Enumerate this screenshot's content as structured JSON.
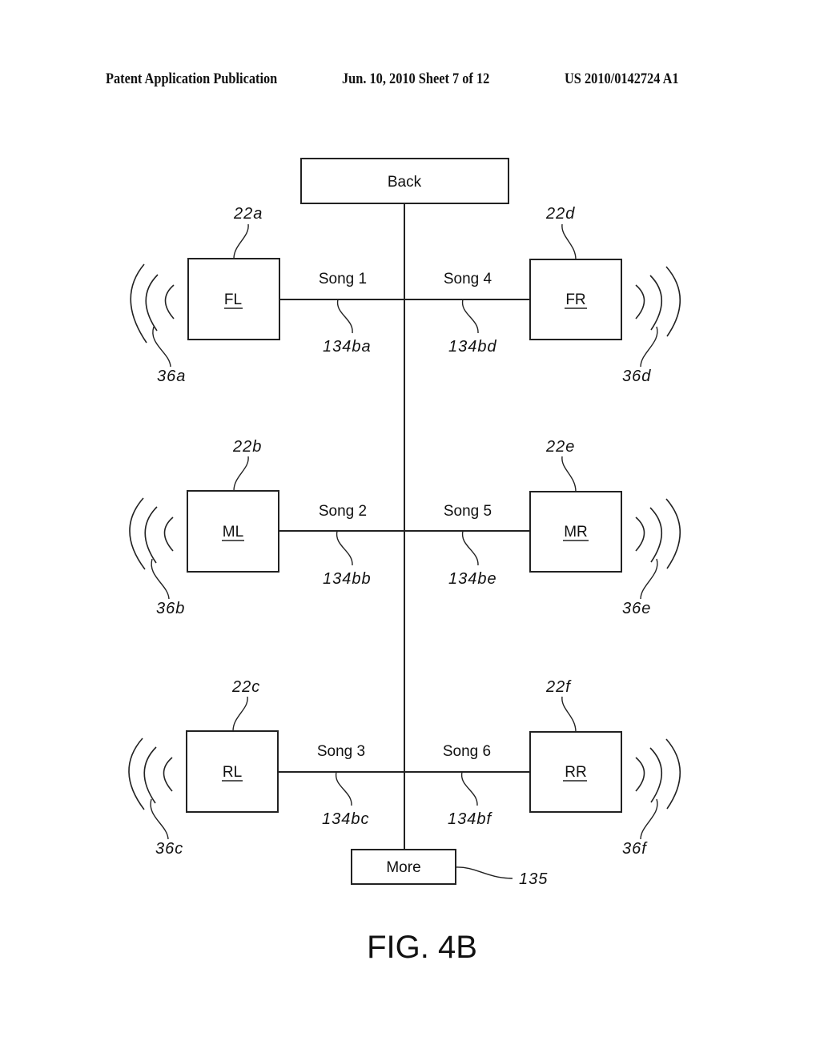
{
  "header": {
    "left": "Patent Application Publication",
    "center": "Jun. 10, 2010  Sheet 7 of 12",
    "right": "US 2010/0142724 A1"
  },
  "diagram": {
    "top_button": "Back",
    "bottom_button": {
      "label": "More",
      "ref": "135"
    },
    "speakers": [
      {
        "id": "FL",
        "ref": "22a",
        "wave_ref": "36a",
        "side": "left",
        "row": 0
      },
      {
        "id": "ML",
        "ref": "22b",
        "wave_ref": "36b",
        "side": "left",
        "row": 1
      },
      {
        "id": "RL",
        "ref": "22c",
        "wave_ref": "36c",
        "side": "left",
        "row": 2
      },
      {
        "id": "FR",
        "ref": "22d",
        "wave_ref": "36d",
        "side": "right",
        "row": 0
      },
      {
        "id": "MR",
        "ref": "22e",
        "wave_ref": "36e",
        "side": "right",
        "row": 1
      },
      {
        "id": "RR",
        "ref": "22f",
        "wave_ref": "36f",
        "side": "right",
        "row": 2
      }
    ],
    "links": [
      {
        "song": "Song 1",
        "ref": "134ba"
      },
      {
        "song": "Song 2",
        "ref": "134bb"
      },
      {
        "song": "Song 3",
        "ref": "134bc"
      },
      {
        "song": "Song 4",
        "ref": "134bd"
      },
      {
        "song": "Song 5",
        "ref": "134be"
      },
      {
        "song": "Song 6",
        "ref": "134bf"
      }
    ],
    "figure_label": "FIG. 4B"
  }
}
